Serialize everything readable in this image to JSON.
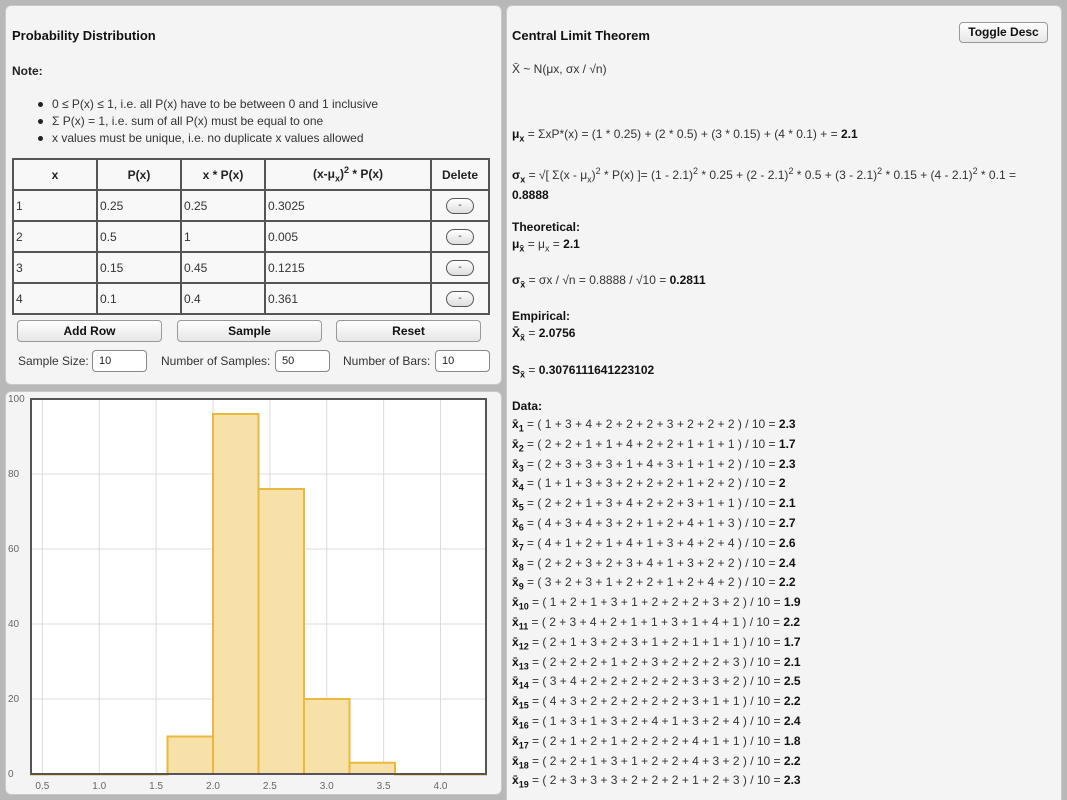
{
  "left": {
    "title": "Probability Distribution",
    "note_label": "Note:",
    "notes": [
      "0 ≤ P(x) ≤ 1, i.e. all P(x) have to be between 0 and 1 inclusive",
      "Σ P(x) = 1, i.e. sum of all P(x) must be equal to one",
      "x values must be unique, i.e. no duplicate x values allowed"
    ],
    "table": {
      "headers": [
        "x",
        "P(x)",
        "x * P(x)",
        "(x-μx)2 * P(x)",
        "Delete"
      ],
      "rows": [
        [
          "1",
          "0.25",
          "0.25",
          "0.3025"
        ],
        [
          "2",
          "0.5",
          "1",
          "0.005"
        ],
        [
          "3",
          "0.15",
          "0.45",
          "0.1215"
        ],
        [
          "4",
          "0.1",
          "0.4",
          "0.361"
        ]
      ],
      "delete_label": "-"
    },
    "buttons": {
      "add_row": "Add Row",
      "sample": "Sample",
      "reset": "Reset"
    },
    "fields": {
      "sample_size_label": "Sample Size:",
      "sample_size": "10",
      "num_samples_label": "Number of Samples:",
      "num_samples": "50",
      "num_bars_label": "Number of Bars:",
      "num_bars": "10"
    }
  },
  "chart_data": {
    "type": "bar",
    "title": "",
    "xlabel": "",
    "ylabel": "",
    "bin_edges": [
      0.4,
      0.8,
      1.2,
      1.6,
      2.0,
      2.4,
      2.8,
      3.2,
      3.6,
      4.0,
      4.4
    ],
    "values": [
      0,
      0,
      0,
      10,
      96,
      76,
      20,
      3,
      0,
      0
    ],
    "xlim": [
      0.4,
      4.4
    ],
    "ylim": [
      0,
      100
    ],
    "xticks": [
      "0.5",
      "1.0",
      "1.5",
      "2.0",
      "2.5",
      "3.0",
      "3.5",
      "4.0"
    ],
    "yticks": [
      "0",
      "20",
      "40",
      "60",
      "80",
      "100"
    ],
    "grid": true,
    "colors": {
      "fill": "#f7e1a9",
      "stroke": "#e8b93c"
    }
  },
  "right": {
    "title": "Central Limit Theorem",
    "toggle_label": "Toggle Desc",
    "dist_formula": "X̄ ~ N(μx, σx / √n)",
    "mu_expr": " = ΣxP*(x) = (1 * 0.25) + (2 * 0.5) + (3 * 0.15) + (4 * 0.1) + = ",
    "mu_value": "2.1",
    "sigma_value": "0.8888",
    "theoretical_label": "Theoretical:",
    "mu_xbar_value": "2.1",
    "sigma_xbar_expr": " = σx / √n = 0.8888 / √10 = ",
    "sigma_xbar_value": "0.2811",
    "empirical_label": "Empirical:",
    "xbar_mean_value": "2.0756",
    "s_value": "0.3076111641223102",
    "data_label": "Data:",
    "samples": [
      {
        "i": "1",
        "expr": " = ( 1 + 3 + 4 + 2 + 2 + 2 + 3 + 2 + 2 + 2 ) / 10 = ",
        "v": "2.3"
      },
      {
        "i": "2",
        "expr": " = ( 2 + 2 + 1 + 1 + 4 + 2 + 2 + 1 + 1 + 1 ) / 10 = ",
        "v": "1.7"
      },
      {
        "i": "3",
        "expr": " = ( 2 + 3 + 3 + 3 + 1 + 4 + 3 + 1 + 1 + 2 ) / 10 = ",
        "v": "2.3"
      },
      {
        "i": "4",
        "expr": " = ( 1 + 1 + 3 + 3 + 2 + 2 + 2 + 1 + 2 + 2 ) / 10 = ",
        "v": "2"
      },
      {
        "i": "5",
        "expr": " = ( 2 + 2 + 1 + 3 + 4 + 2 + 2 + 3 + 1 + 1 ) / 10 = ",
        "v": "2.1"
      },
      {
        "i": "6",
        "expr": " = ( 4 + 3 + 4 + 3 + 2 + 1 + 2 + 4 + 1 + 3 ) / 10 = ",
        "v": "2.7"
      },
      {
        "i": "7",
        "expr": " = ( 4 + 1 + 2 + 1 + 4 + 1 + 3 + 4 + 2 + 4 ) / 10 = ",
        "v": "2.6"
      },
      {
        "i": "8",
        "expr": " = ( 2 + 2 + 3 + 2 + 3 + 4 + 1 + 3 + 2 + 2 ) / 10 = ",
        "v": "2.4"
      },
      {
        "i": "9",
        "expr": " = ( 3 + 2 + 3 + 1 + 2 + 2 + 1 + 2 + 4 + 2 ) / 10 = ",
        "v": "2.2"
      },
      {
        "i": "10",
        "expr": " = ( 1 + 2 + 1 + 3 + 1 + 2 + 2 + 2 + 3 + 2 ) / 10 = ",
        "v": "1.9"
      },
      {
        "i": "11",
        "expr": " = ( 2 + 3 + 4 + 2 + 1 + 1 + 3 + 1 + 4 + 1 ) / 10 = ",
        "v": "2.2"
      },
      {
        "i": "12",
        "expr": " = ( 2 + 1 + 3 + 2 + 3 + 1 + 2 + 1 + 1 + 1 ) / 10 = ",
        "v": "1.7"
      },
      {
        "i": "13",
        "expr": " = ( 2 + 2 + 2 + 1 + 2 + 3 + 2 + 2 + 2 + 3 ) / 10 = ",
        "v": "2.1"
      },
      {
        "i": "14",
        "expr": " = ( 3 + 4 + 2 + 2 + 2 + 2 + 2 + 3 + 3 + 2 ) / 10 = ",
        "v": "2.5"
      },
      {
        "i": "15",
        "expr": " = ( 4 + 3 + 2 + 2 + 2 + 2 + 2 + 3 + 1 + 1 ) / 10 = ",
        "v": "2.2"
      },
      {
        "i": "16",
        "expr": " = ( 1 + 3 + 1 + 3 + 2 + 4 + 1 + 3 + 2 + 4 ) / 10 = ",
        "v": "2.4"
      },
      {
        "i": "17",
        "expr": " = ( 2 + 1 + 2 + 1 + 2 + 2 + 2 + 4 + 1 + 1 ) / 10 = ",
        "v": "1.8"
      },
      {
        "i": "18",
        "expr": " = ( 2 + 2 + 1 + 3 + 1 + 2 + 2 + 4 + 3 + 2 ) / 10 = ",
        "v": "2.2"
      },
      {
        "i": "19",
        "expr": " = ( 2 + 3 + 3 + 3 + 2 + 2 + 2 + 1 + 2 + 3 ) / 10 = ",
        "v": "2.3"
      }
    ]
  }
}
